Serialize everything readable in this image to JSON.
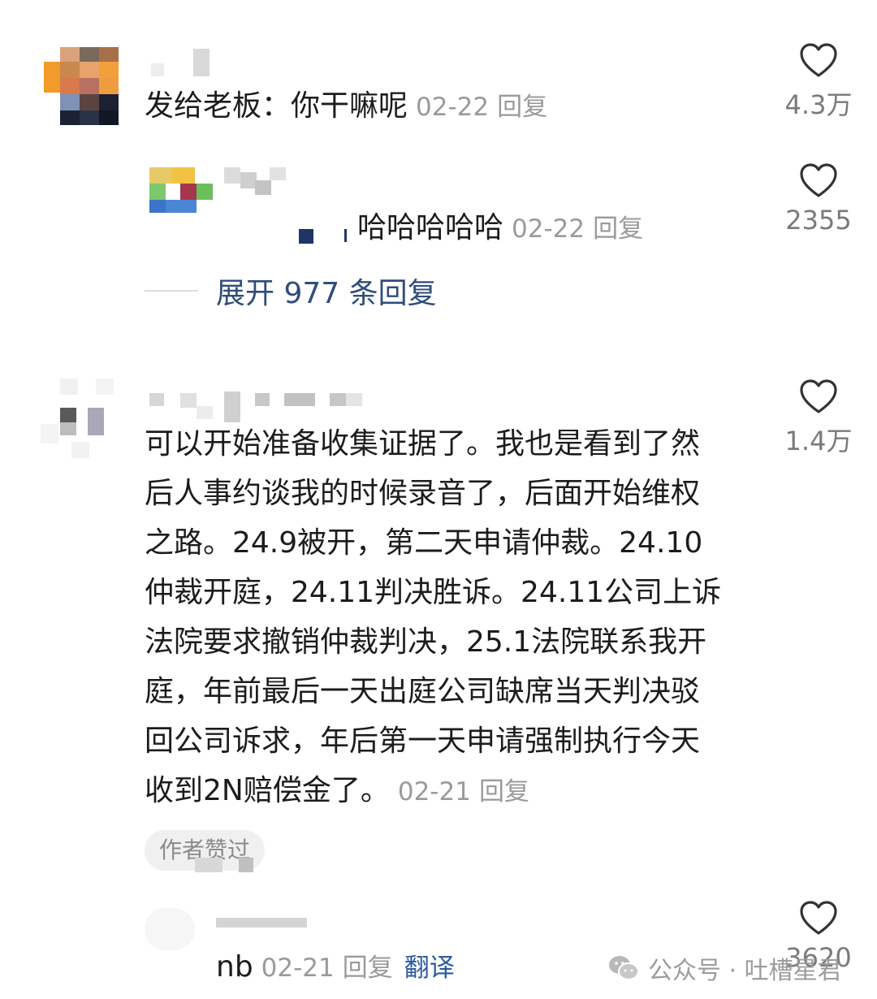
{
  "comments": [
    {
      "text": "发给老板：你干嘛呢",
      "date": "02-22",
      "reply_label": "回复",
      "likes": "4.3万"
    },
    {
      "text": "哈哈哈哈哈",
      "date": "02-22",
      "reply_label": "回复",
      "likes": "2355"
    },
    {
      "lines": [
        "可以开始准备收集证据了。我也是看到了然",
        "后人事约谈我的时候录音了，后面开始维权",
        "之路。24.9被开，第二天申请仲裁。24.10",
        "仲裁开庭，24.11判决胜诉。24.11公司上诉",
        "法院要求撤销仲裁判决，25.1法院联系我开",
        "庭，年前最后一天出庭公司缺席当天判决驳",
        "回公司诉求，年后第一天申请强制执行今天",
        "收到2N赔偿金了。"
      ],
      "date": "02-21",
      "reply_label": "回复",
      "likes": "1.4万",
      "badge": "作者赞过"
    },
    {
      "text": "nb",
      "date": "02-21",
      "reply_label": "回复",
      "translate_label": "翻译",
      "likes": "3620"
    }
  ],
  "expand_replies": "展开 977 条回复",
  "watermark": "公众号 · 吐槽星君",
  "colors": {
    "link": "#2f4d7a",
    "meta": "#9a9a9a",
    "text": "#1c1c1c"
  }
}
